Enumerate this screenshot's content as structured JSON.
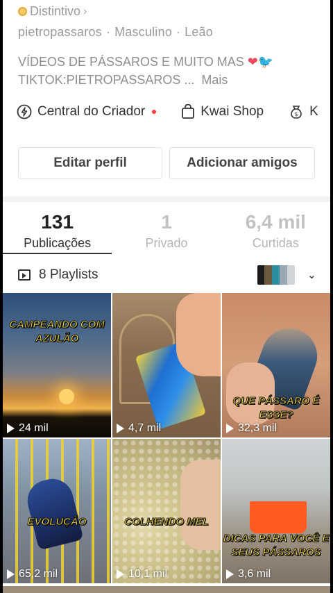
{
  "badge": {
    "label": "Distintivo"
  },
  "user": {
    "handle": "pietropassaros",
    "gender": "Masculino",
    "sign": "Leão"
  },
  "bio": {
    "line1": "VÍDEOS DE PÁSSAROS E MUITO MAS",
    "line2": "TIKTOK:PIETROPASSAROS ...",
    "more": "Mais"
  },
  "links": [
    {
      "label": "Central do Criador",
      "icon": "lightning-icon"
    },
    {
      "label": "Kwai Shop",
      "icon": "shopping-bag-icon"
    },
    {
      "label": "K",
      "icon": "money-bag-icon"
    }
  ],
  "buttons": {
    "edit": "Editar perfil",
    "add": "Adicionar amigos"
  },
  "stats": [
    {
      "value": "131",
      "label": "Publicações"
    },
    {
      "value": "1",
      "label": "Privado"
    },
    {
      "value": "6,4 mil",
      "label": "Curtidas"
    }
  ],
  "playlists": {
    "label": "8 Playlists"
  },
  "videos": [
    {
      "caption": "CAMPEANDO COM AZULÃO",
      "views": "24 mil"
    },
    {
      "caption": "",
      "views": "4,7 mil"
    },
    {
      "caption": "QUE PÁSSARO É ESSE?",
      "views": "32,3 mil"
    },
    {
      "caption": "EVOLUÇÃO",
      "views": "65,2 mil"
    },
    {
      "caption": "COLHENDO MEL",
      "views": "10,1 mil"
    },
    {
      "caption": "DICAS PARA VOCÊ E SEUS PÁSSAROS",
      "views": "3,6 mil"
    }
  ],
  "colors": {
    "accent_red": "#ff3b3b",
    "caption_yellow": "#ffe23a"
  }
}
